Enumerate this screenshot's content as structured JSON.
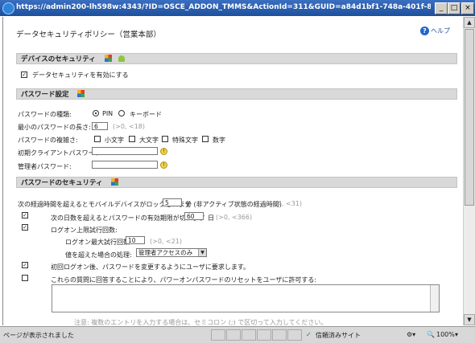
{
  "window": {
    "title": "https://admin200-lh598w:4343/?ID=OSCE_ADDON_TMMS&ActionId=311&GUID=a84d1bf1-748a-401f-8fde-e9b9 - Windows I...",
    "minimize": "_",
    "maximize": "□",
    "close": "×"
  },
  "page": {
    "title": "データセキュリティポリシー（営業本部）",
    "help_label": "ヘルプ"
  },
  "sections": {
    "device": "デバイスのセキュリティ",
    "password_settings": "パスワード設定",
    "password_security": "パスワードのセキュリティ"
  },
  "device": {
    "enable_data_security": "データセキュリティを有効にする",
    "enable_checked": true
  },
  "password": {
    "type_label": "パスワードの種類:",
    "type_options": [
      "PIN",
      "キーボード"
    ],
    "min_length_label": "最小のパスワードの長さ:",
    "min_length_value": "6",
    "min_length_hint": "(>0, <18)",
    "complexity_label": "パスワードの複雑さ:",
    "complexity_options": [
      "小文字",
      "大文字",
      "特殊文字",
      "数字"
    ],
    "initial_client_label": "初期クライアントパスワード:",
    "admin_label": "管理者パスワード:"
  },
  "security": {
    "lock_text": "次の経過時間を超えるとモバイルデバイスがロックされます",
    "lock_value": "5",
    "lock_unit": "分 (非アクティブ状態の経過時間)",
    "lock_hint": "(>4, <31)",
    "expire_text": "次の日数を超えるとパスワードの有効期限が切れます",
    "expire_value": "60",
    "expire_unit": "日",
    "expire_hint": "(>0, <366)",
    "expire_checked": true,
    "logon_limit_text": "ログオン上限試行回数:",
    "logon_limit_checked": true,
    "max_attempts_label": "ログオン最大試行回数:",
    "max_attempts_value": "10",
    "max_attempts_hint": "(>0, <21)",
    "exceed_action_label": "値を超えた場合の処理:",
    "exceed_action_value": "管理者アクセスのみ",
    "first_logon_text": "初回ログオン後、パスワードを変更するようにユーザに要求します。",
    "first_logon_checked": true,
    "reset_text": "これらの質問に回答することにより、パワーオンパスワードのリセットをユーザに許可する:",
    "reset_checked": false,
    "note": "注意: 複数のエントリを入力する場合は、セミコロン (;) で区切って入力してください。"
  },
  "statusbar": {
    "message": "ページが表示されました",
    "zone": "信頼済みサイト",
    "zoom": "100%"
  }
}
